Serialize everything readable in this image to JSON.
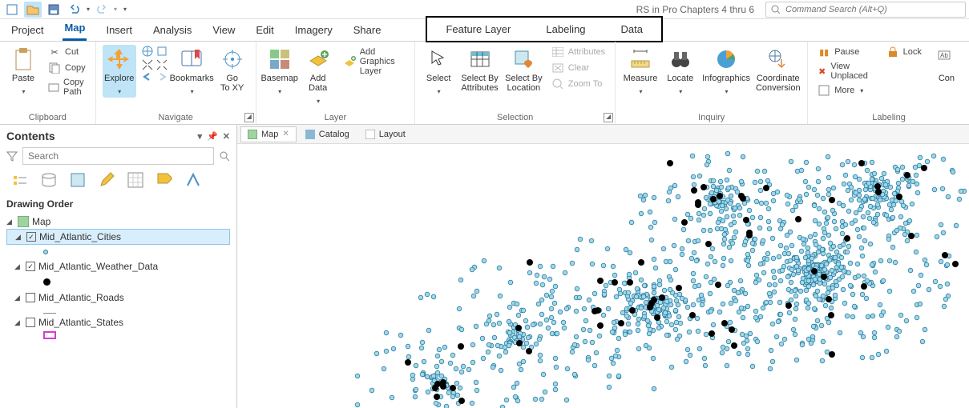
{
  "qat": {
    "title": "RS in Pro Chapters 4 thru 6",
    "search_placeholder": "Command Search (Alt+Q)"
  },
  "tabs": [
    "Project",
    "Map",
    "Insert",
    "Analysis",
    "View",
    "Edit",
    "Imagery",
    "Share"
  ],
  "tabs_active": "Map",
  "context_tabs": [
    "Feature Layer",
    "Labeling",
    "Data"
  ],
  "ribbon": {
    "clipboard": {
      "paste": "Paste",
      "cut": "Cut",
      "copy": "Copy",
      "copypath": "Copy Path",
      "label": "Clipboard"
    },
    "navigate": {
      "explore": "Explore",
      "bookmarks": "Bookmarks",
      "goto": "Go\nTo XY",
      "label": "Navigate"
    },
    "layer": {
      "basemap": "Basemap",
      "adddata": "Add\nData",
      "addgraphics": "Add Graphics Layer",
      "label": "Layer"
    },
    "selection": {
      "select": "Select",
      "byattr": "Select By\nAttributes",
      "byloc": "Select By\nLocation",
      "attributes": "Attributes",
      "clear": "Clear",
      "zoomto": "Zoom To",
      "label": "Selection"
    },
    "inquiry": {
      "measure": "Measure",
      "locate": "Locate",
      "infographics": "Infographics",
      "coord": "Coordinate\nConversion",
      "label": "Inquiry"
    },
    "labeling": {
      "pause": "Pause",
      "lock": "Lock",
      "viewunplaced": "View Unplaced",
      "more": "More",
      "con": "Con",
      "label": "Labeling"
    }
  },
  "doctabs": {
    "map": "Map",
    "catalog": "Catalog",
    "layout": "Layout"
  },
  "contents": {
    "title": "Contents",
    "search_placeholder": "Search",
    "section": "Drawing Order",
    "map_node": "Map",
    "layers": [
      {
        "name": "Mid_Atlantic_Cities",
        "checked": true,
        "selected": true,
        "symbol": "circle-cyan"
      },
      {
        "name": "Mid_Atlantic_Weather_Data",
        "checked": true,
        "selected": false,
        "symbol": "circle-black"
      },
      {
        "name": "Mid_Atlantic_Roads",
        "checked": false,
        "selected": false,
        "symbol": "line"
      },
      {
        "name": "Mid_Atlantic_States",
        "checked": false,
        "selected": false,
        "symbol": "rect"
      }
    ]
  }
}
